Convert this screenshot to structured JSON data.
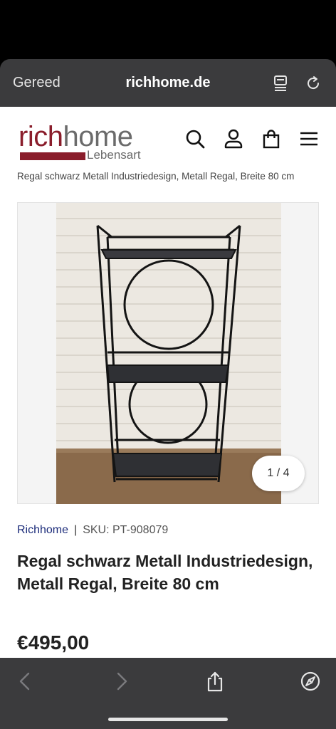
{
  "browser": {
    "done_label": "Gereed",
    "url": "richhome.de"
  },
  "header": {
    "logo_primary": "rich",
    "logo_secondary": "home",
    "logo_sub": "Lebensart",
    "icons": [
      "search-icon",
      "account-icon",
      "shopping-bag-icon",
      "menu-icon"
    ]
  },
  "breadcrumb": "Regal schwarz Metall Industriedesign, Metall Regal, Breite 80 cm",
  "gallery": {
    "counter": "1 / 4"
  },
  "product": {
    "brand": "Richhome",
    "separator": "|",
    "sku": "SKU: PT-908079",
    "title": "Regal schwarz Metall Industriedesign, Metall Regal, Breite 80 cm",
    "price": "€495,00"
  },
  "toolbar_icons": [
    "back-icon",
    "forward-icon",
    "share-icon",
    "compass-icon"
  ],
  "colors": {
    "brand_red": "#8a1d2b",
    "brand_link": "#1c2c7a",
    "browser_chrome": "#3b3b3d"
  }
}
